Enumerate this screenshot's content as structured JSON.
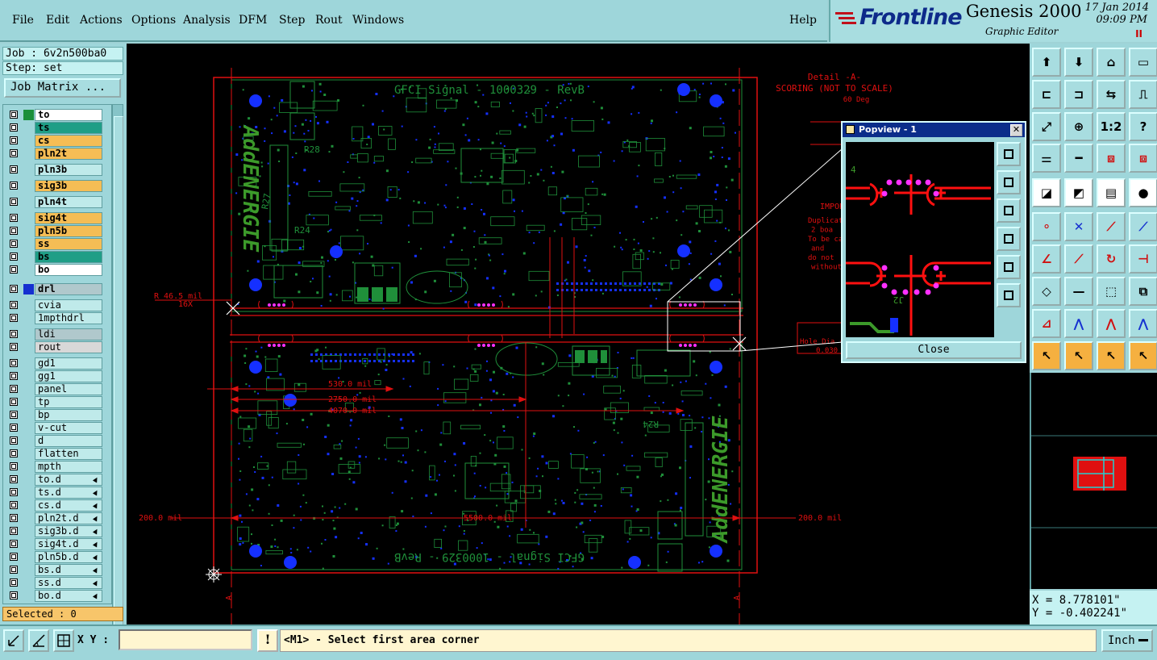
{
  "menu": {
    "items": [
      "File",
      "Edit",
      "Actions",
      "Options",
      "Analysis",
      "DFM",
      "Step",
      "Rout",
      "Windows"
    ],
    "help": "Help"
  },
  "brand": {
    "logo": "Frontline",
    "product": "Genesis 2000",
    "subtitle": "Graphic Editor",
    "date": "17 Jan 2014",
    "time": "09:09 PM",
    "pause": "II"
  },
  "left": {
    "job": "Job : 6v2n500ba0",
    "step": "Step: set",
    "job_matrix": "Job Matrix ...",
    "selected": "Selected : 0",
    "layers": [
      {
        "name": "to",
        "bg": "#ffffff",
        "swatch": "#1a8f3a",
        "bold": true
      },
      {
        "name": "ts",
        "bg": "#1f9e86",
        "swatch": "",
        "bold": true
      },
      {
        "name": "cs",
        "bg": "#f5bd55",
        "swatch": "",
        "bold": true
      },
      {
        "name": "pln2t",
        "bg": "#f5bd55",
        "swatch": "",
        "bold": true
      },
      {
        "name": "pln3b",
        "bg": "#bfeaea",
        "swatch": "",
        "bold": true
      },
      {
        "name": "sig3b",
        "bg": "#f5bd55",
        "swatch": "",
        "bold": true
      },
      {
        "name": "pln4t",
        "bg": "#bfeaea",
        "swatch": "",
        "bold": true
      },
      {
        "name": "sig4t",
        "bg": "#f5bd55",
        "swatch": "",
        "bold": true
      },
      {
        "name": "pln5b",
        "bg": "#f5bd55",
        "swatch": "",
        "bold": true
      },
      {
        "name": "ss",
        "bg": "#f5bd55",
        "swatch": "",
        "bold": true
      },
      {
        "name": "bs",
        "bg": "#1f9e86",
        "swatch": "",
        "bold": true
      },
      {
        "name": "bo",
        "bg": "#ffffff",
        "swatch": "",
        "bold": true
      },
      {
        "name": "drl",
        "bg": "#b0c8cc",
        "swatch": "#1530d0",
        "bold": true
      },
      {
        "name": "cvia",
        "bg": "#bfeaea",
        "swatch": "",
        "bold": false
      },
      {
        "name": "1mpthdrl",
        "bg": "#bfeaea",
        "swatch": "",
        "bold": false
      },
      {
        "name": "ldi",
        "bg": "#b0c8cc",
        "swatch": "",
        "bold": false
      },
      {
        "name": "rout",
        "bg": "#d8d8d8",
        "swatch": "",
        "bold": false
      },
      {
        "name": "gd1",
        "bg": "#bfeaea",
        "swatch": "",
        "bold": false
      },
      {
        "name": "gg1",
        "bg": "#bfeaea",
        "swatch": "",
        "bold": false
      },
      {
        "name": "panel",
        "bg": "#bfeaea",
        "swatch": "",
        "bold": false
      },
      {
        "name": "tp",
        "bg": "#bfeaea",
        "swatch": "",
        "bold": false
      },
      {
        "name": "bp",
        "bg": "#bfeaea",
        "swatch": "",
        "bold": false
      },
      {
        "name": "v-cut",
        "bg": "#bfeaea",
        "swatch": "",
        "bold": false
      },
      {
        "name": "d",
        "bg": "#bfeaea",
        "swatch": "",
        "bold": false
      },
      {
        "name": "flatten",
        "bg": "#bfeaea",
        "swatch": "",
        "bold": false
      },
      {
        "name": "mpth",
        "bg": "#bfeaea",
        "swatch": "",
        "bold": false
      },
      {
        "name": "to.d",
        "bg": "#bfeaea",
        "swatch": "",
        "bold": false,
        "flag": true
      },
      {
        "name": "ts.d",
        "bg": "#bfeaea",
        "swatch": "",
        "bold": false,
        "flag": true
      },
      {
        "name": "cs.d",
        "bg": "#bfeaea",
        "swatch": "",
        "bold": false,
        "flag": true
      },
      {
        "name": "pln2t.d",
        "bg": "#bfeaea",
        "swatch": "",
        "bold": false,
        "flag": true
      },
      {
        "name": "sig3b.d",
        "bg": "#bfeaea",
        "swatch": "",
        "bold": false,
        "flag": true
      },
      {
        "name": "sig4t.d",
        "bg": "#bfeaea",
        "swatch": "",
        "bold": false,
        "flag": true
      },
      {
        "name": "pln5b.d",
        "bg": "#bfeaea",
        "swatch": "",
        "bold": false,
        "flag": true
      },
      {
        "name": "bs.d",
        "bg": "#bfeaea",
        "swatch": "",
        "bold": false,
        "flag": true
      },
      {
        "name": "ss.d",
        "bg": "#bfeaea",
        "swatch": "",
        "bold": false,
        "flag": true
      },
      {
        "name": "bo.d",
        "bg": "#bfeaea",
        "swatch": "",
        "bold": false,
        "flag": true
      }
    ]
  },
  "canvas": {
    "board_title_top": "GFCI Signal - 1000329 - RevB",
    "board_title_bottom": "GFCI Signal - 1000329 - RevB",
    "logo_text": "AddENERGIE",
    "detail_title": "Detail -A-",
    "detail_sub": "SCORING (NOT TO SCALE)",
    "detail_angle": "60 Deg",
    "radius_note": "R 46.5 mil",
    "radius_qty": "16X",
    "dim_530": "530.0 mil",
    "dim_2750": "2750.0 mil",
    "dim_4070": "4070.0 mil",
    "dim_5500": "5500.0 mil",
    "dim_left_200": "200.0 mil",
    "dim_right_200": "200.0 mil",
    "important": "IMPOR",
    "note_lines": [
      "Duplicate",
      "2 boa",
      "To be car",
      "and",
      "do not",
      "without"
    ],
    "hole_note": "Hole Dia (i",
    "hole_val": "0.030",
    "section_mark": "A",
    "ref_r28": "R28",
    "ref_r27": "R27",
    "ref_r24": "R24",
    "popview": {
      "title": "Popview - 1",
      "close": "Close",
      "layer_no": "4",
      "label": "J2"
    }
  },
  "readout": {
    "x": "X = 8.778101\"",
    "y": "Y = -0.402241\""
  },
  "status": {
    "xy_label": "X Y :",
    "xy_value": "",
    "warn": "!",
    "prompt": "<M1> - Select first area corner",
    "units": "Inch"
  }
}
